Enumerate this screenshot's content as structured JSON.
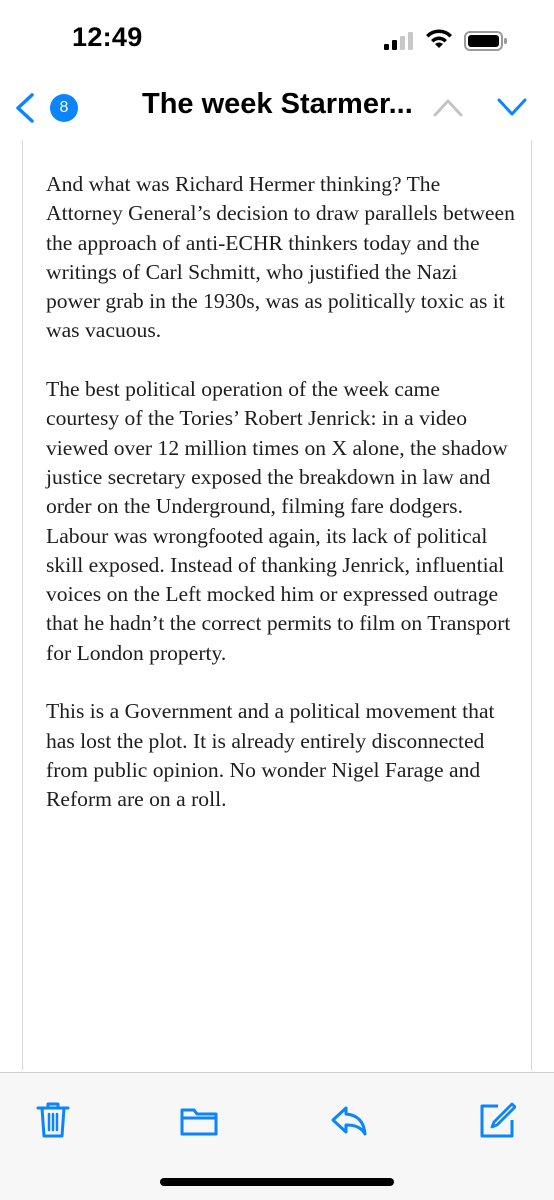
{
  "status_bar": {
    "time": "12:49"
  },
  "nav": {
    "unread_count": "8",
    "title": "The week Starmer..."
  },
  "article": {
    "paragraphs": [
      "And what was Richard Hermer thinking? The Attorney General’s decision to draw parallels between the approach of anti-ECHR thinkers today and the writings of Carl Schmitt, who justified the Nazi power grab in the 1930s, was as politically toxic as it was vacuous.",
      "The best political operation of the week came courtesy of the Tories’ Robert Jenrick: in a video viewed over 12 million times on X alone, the shadow justice secretary exposed the breakdown in law and order on the Underground, filming fare dodgers. Labour was wrongfooted again, its lack of political skill exposed. Instead of thanking Jenrick, influential voices on the Left mocked him or expressed outrage that he hadn’t the correct permits to film on Transport for London property.",
      "This is a Government and a political movement that has lost the plot. It is already entirely disconnected from public opinion. No wonder Nigel Farage and Reform are on a roll."
    ]
  },
  "colors": {
    "accent": "#0a84ff",
    "toolbar_bg": "#f7f7f7",
    "text": "#1d1d1d"
  },
  "icons": {
    "status": [
      "signal-icon",
      "wifi-icon",
      "battery-icon"
    ],
    "nav": [
      "back-chevron-icon",
      "up-chevron-icon",
      "down-chevron-icon"
    ],
    "toolbar": [
      "trash-icon",
      "folder-icon",
      "reply-icon",
      "compose-icon"
    ]
  }
}
